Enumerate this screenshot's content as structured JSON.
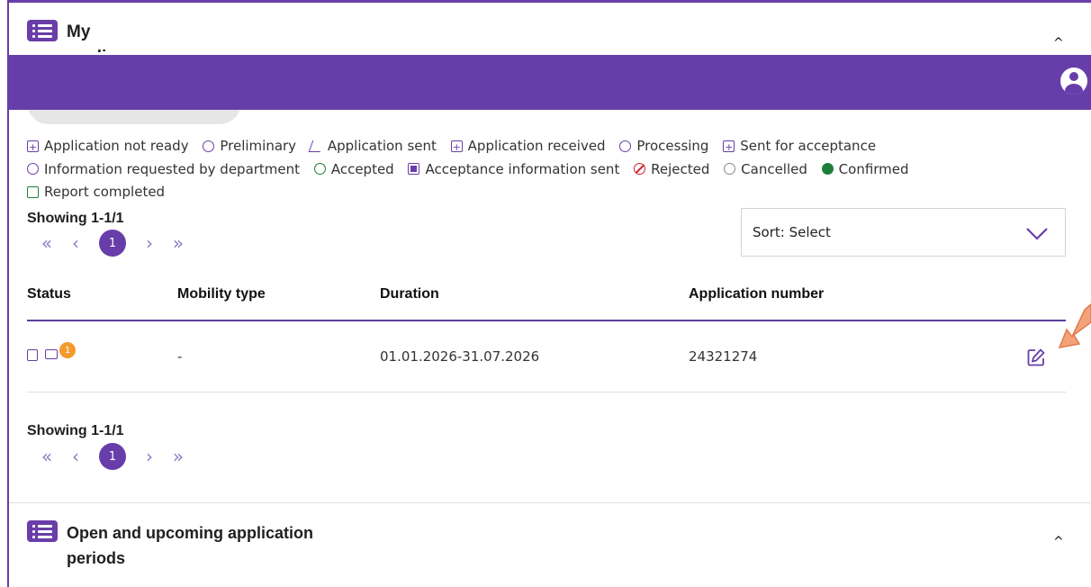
{
  "header": {
    "section_title": "My applications",
    "collapse_glyph": "^"
  },
  "legend": [
    {
      "label": "Application not ready",
      "icon": "document-plus-icon"
    },
    {
      "label": "Preliminary",
      "icon": "edit-circle-icon"
    },
    {
      "label": "Application sent",
      "icon": "paper-plane-icon"
    },
    {
      "label": "Application received",
      "icon": "document-arrow-icon"
    },
    {
      "label": "Processing",
      "icon": "arrow-circle-icon"
    },
    {
      "label": "Sent for acceptance",
      "icon": "document-check-icon"
    },
    {
      "label": "Information requested by department",
      "icon": "info-circle-icon"
    },
    {
      "label": "Accepted",
      "icon": "check-circle-icon"
    },
    {
      "label": "Acceptance information sent",
      "icon": "envelope-icon"
    },
    {
      "label": "Rejected",
      "icon": "ban-icon"
    },
    {
      "label": "Cancelled",
      "icon": "x-circle-icon"
    },
    {
      "label": "Confirmed",
      "icon": "check-filled-icon"
    },
    {
      "label": "Report completed",
      "icon": "document-check-green-icon"
    }
  ],
  "pagination_top": {
    "showing": "Showing 1-1/1",
    "current_page": "1"
  },
  "pagination_bottom": {
    "showing": "Showing 1-1/1",
    "current_page": "1"
  },
  "sort": {
    "label": "Sort: Select"
  },
  "table": {
    "columns": [
      "Status",
      "Mobility type",
      "Duration",
      "Application number"
    ],
    "rows": [
      {
        "badge": "1",
        "mobility_type": "-",
        "duration": "01.01.2026-31.07.2026",
        "application_number": "24321274"
      }
    ]
  },
  "section2": {
    "title": "Open and upcoming application periods",
    "collapse_glyph": "^"
  },
  "colors": {
    "brand_purple": "#673ea9",
    "badge_orange": "#f39b2f",
    "reject_red": "#d1202a",
    "confirm_green": "#1e7f3b"
  }
}
